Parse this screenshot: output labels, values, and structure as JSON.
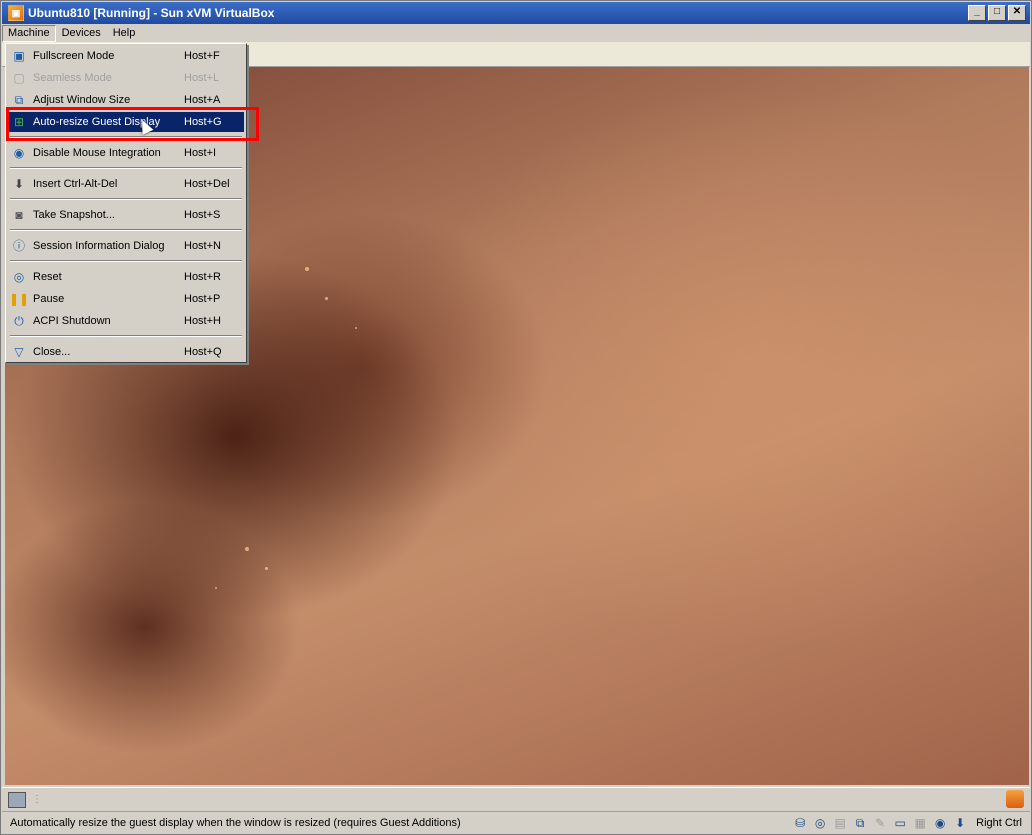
{
  "window": {
    "title": "Ubuntu810 [Running] - Sun xVM VirtualBox",
    "minimize": "_",
    "maximize": "□",
    "close": "✕"
  },
  "menubar": {
    "items": [
      "Machine",
      "Devices",
      "Help"
    ]
  },
  "machine_menu": {
    "items": [
      {
        "label": "Fullscreen Mode",
        "shortcut": "Host+F",
        "icon": "monitor-icon",
        "enabled": true
      },
      {
        "label": "Seamless Mode",
        "shortcut": "Host+L",
        "icon": "seamless-icon",
        "enabled": false
      },
      {
        "label": "Adjust Window Size",
        "shortcut": "Host+A",
        "icon": "resize-icon",
        "enabled": true
      },
      {
        "label": "Auto-resize Guest Display",
        "shortcut": "Host+G",
        "icon": "auto-resize-icon",
        "enabled": true,
        "highlighted": true
      },
      {
        "label": "Disable Mouse Integration",
        "shortcut": "Host+I",
        "icon": "mouse-integration-icon",
        "enabled": true
      },
      {
        "label": "Insert Ctrl-Alt-Del",
        "shortcut": "Host+Del",
        "icon": "keyboard-icon",
        "enabled": true
      },
      {
        "label": "Take Snapshot...",
        "shortcut": "Host+S",
        "icon": "camera-icon",
        "enabled": true
      },
      {
        "label": "Session Information Dialog",
        "shortcut": "Host+N",
        "icon": "info-icon",
        "enabled": true
      },
      {
        "label": "Reset",
        "shortcut": "Host+R",
        "icon": "reset-icon",
        "enabled": true
      },
      {
        "label": "Pause",
        "shortcut": "Host+P",
        "icon": "pause-icon",
        "enabled": true
      },
      {
        "label": "ACPI Shutdown",
        "shortcut": "Host+H",
        "icon": "power-icon",
        "enabled": true
      },
      {
        "label": "Close...",
        "shortcut": "Host+Q",
        "icon": "close-triangle-icon",
        "enabled": true
      }
    ]
  },
  "statusbar": {
    "message": "Automatically resize the guest display when the window is resized (requires Guest Additions)",
    "host_key": "Right Ctrl"
  },
  "colors": {
    "highlight": "#0a246a",
    "annotation": "#ff0000",
    "titlebar": "#2a56b0"
  }
}
